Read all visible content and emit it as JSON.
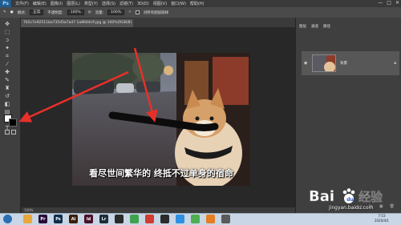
{
  "menubar": {
    "logo": "Ps",
    "items": [
      "文件(F)",
      "编辑(E)",
      "图像(I)",
      "图层(L)",
      "类型(Y)",
      "选择(S)",
      "滤镜(T)",
      "3D(D)",
      "视图(V)",
      "窗口(W)",
      "帮助(H)"
    ],
    "window_controls": [
      "—",
      "□",
      "✕"
    ]
  },
  "options": {
    "feather_label": "羽化:",
    "feather_value": "0 像素",
    "mode_label": "模式:",
    "mode_value": "正常",
    "opacity_label": "不透明度:",
    "opacity_value": "100%",
    "flow_label": "流量:",
    "flow_value": "100%",
    "sample_label": "对所有图层取样"
  },
  "document": {
    "tab_title": "7b5c7e92511ba735d5a7ad7 1a8644c9.jpg @ 100%(RGB/8)",
    "caption": "看尽世间繁华的 终抵不过单身的宿命",
    "status": "100%"
  },
  "panels": {
    "tabs": [
      "图层",
      "通道",
      "路径"
    ],
    "layer_name": "背景"
  },
  "watermark": {
    "brand": "Bai",
    "brand_suffix": "经验",
    "site": "jingyan.baidu.com"
  },
  "taskbar": {
    "apps": [
      {
        "label": "",
        "color": "#e8a73a"
      },
      {
        "label": "Pr",
        "color": "#2a0e3a"
      },
      {
        "label": "Ps",
        "color": "#0f2d4a"
      },
      {
        "label": "Ai",
        "color": "#3a1f0a"
      },
      {
        "label": "Id",
        "color": "#4a0f2a"
      },
      {
        "label": "Lr",
        "color": "#1c2c3a"
      },
      {
        "label": "",
        "color": "#2a2a2a"
      },
      {
        "label": "",
        "color": "#3fa34d"
      },
      {
        "label": "",
        "color": "#d23b2f"
      },
      {
        "label": "",
        "color": "#2b2b2b"
      },
      {
        "label": "",
        "color": "#2f8fe0"
      },
      {
        "label": "",
        "color": "#4caf50"
      },
      {
        "label": "",
        "color": "#e67e22"
      },
      {
        "label": "",
        "color": "#5a5a5a"
      }
    ],
    "time": "7:53",
    "date": "2020/4/1"
  },
  "colors": {
    "ps_blue": "#1f5d8f",
    "arrow_red": "#e8302a",
    "foreground": "#ffffff",
    "background": "#000000"
  }
}
